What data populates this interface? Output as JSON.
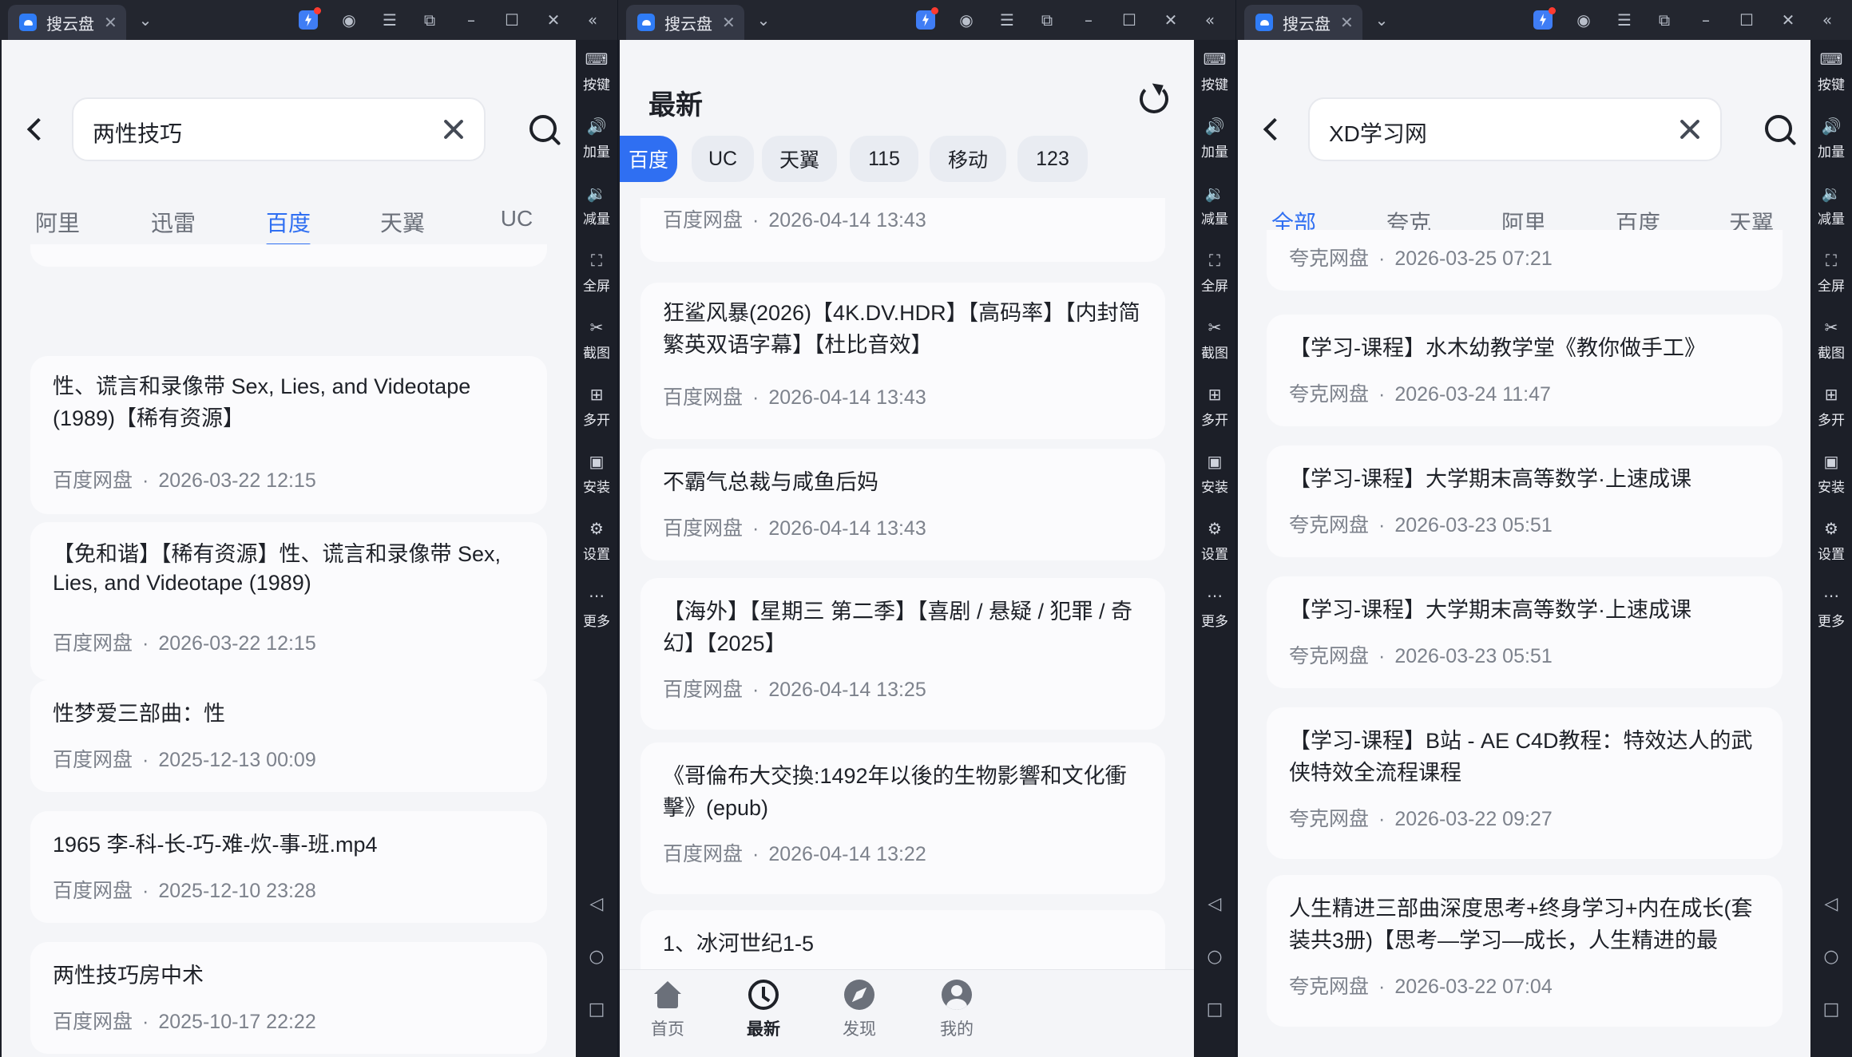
{
  "tab_title": "搜云盘",
  "tab_close": "✕",
  "rail": [
    "按键",
    "加量",
    "减量",
    "全屏",
    "截图",
    "多开",
    "安装",
    "设置",
    "更多"
  ],
  "w1": {
    "query": "两性技巧",
    "tabs": [
      "阿里",
      "迅雷",
      "百度",
      "天翼",
      "UC"
    ],
    "cards": [
      {
        "title": "性、谎言和录像带 Sex, Lies, and Videotape (1989)【稀有资源】",
        "source": "百度网盘",
        "time": "2026-03-22 12:15"
      },
      {
        "title": "【免和谐】【稀有资源】性、谎言和录像带 Sex, Lies, and Videotape (1989)",
        "source": "百度网盘",
        "time": "2026-03-22 12:15"
      },
      {
        "title": "性梦爱三部曲：性",
        "source": "百度网盘",
        "time": "2025-12-13 00:09"
      },
      {
        "title": "1965 李-科-长-巧-难-炊-事-班.mp4",
        "source": "百度网盘",
        "time": "2025-12-10 23:28"
      },
      {
        "title": "两性技巧房中术",
        "source": "百度网盘",
        "time": "2025-10-17 22:22"
      }
    ]
  },
  "w2": {
    "title": "最新",
    "chips": [
      "百度",
      "UC",
      "天翼",
      "115",
      "移动",
      "123"
    ],
    "cards": [
      {
        "title": "",
        "source": "百度网盘",
        "time": "2026-04-14 13:43"
      },
      {
        "title": "狂鲨风暴(2026)【4K.DV.HDR】【高码率】【内封简繁英双语字幕】【杜比音效】",
        "source": "百度网盘",
        "time": "2026-04-14 13:43"
      },
      {
        "title": "不霸气总裁与咸鱼后妈",
        "source": "百度网盘",
        "time": "2026-04-14 13:43"
      },
      {
        "title": "【海外】【星期三 第二季】【喜剧 / 悬疑 / 犯罪 / 奇幻】【2025】",
        "source": "百度网盘",
        "time": "2026-04-14 13:25"
      },
      {
        "title": "《哥倫布大交換:1492年以後的生物影響和文化衝擊》(epub)",
        "source": "百度网盘",
        "time": "2026-04-14 13:22"
      },
      {
        "title": "1、冰河世纪1-5",
        "source": "",
        "time": ""
      }
    ],
    "nav": [
      "首页",
      "最新",
      "发现",
      "我的"
    ]
  },
  "w3": {
    "query": "XD学习网",
    "tabs": [
      "全部",
      "夸克",
      "阿里",
      "百度",
      "天翼"
    ],
    "cards": [
      {
        "title": "",
        "source": "夸克网盘",
        "time": "2026-03-25 07:21"
      },
      {
        "title": "【学习-课程】水木幼教学堂《教你做手工》",
        "source": "夸克网盘",
        "time": "2026-03-24 11:47"
      },
      {
        "title": "【学习-课程】大学期末高等数学·上速成课",
        "source": "夸克网盘",
        "time": "2026-03-23 05:51"
      },
      {
        "title": "【学习-课程】大学期末高等数学·上速成课",
        "source": "夸克网盘",
        "time": "2026-03-23 05:51"
      },
      {
        "title": "【学习-课程】B站 - AE C4D教程：特效达人的武侠特效全流程课程",
        "source": "夸克网盘",
        "time": "2026-03-22 09:27"
      },
      {
        "title": "人生精进三部曲深度思考+终身学习+内在成长(套装共3册)【思考—学习—成长，人生精进的最",
        "source": "夸克网盘",
        "time": "2026-03-22 07:04"
      }
    ]
  },
  "dot": "·"
}
